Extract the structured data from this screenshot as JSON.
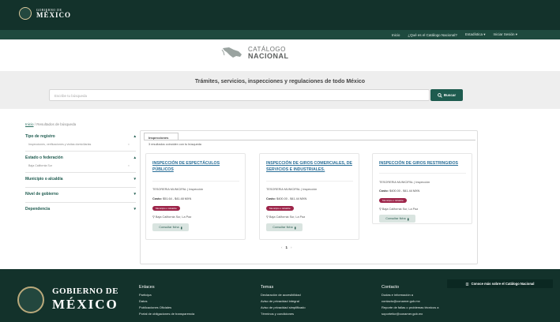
{
  "header": {
    "logo_small": "GOBIERNO DE",
    "logo_big": "MÉXICO"
  },
  "nav": {
    "items": [
      "Inicio",
      "¿Qué es el Catálogo Nacional?",
      "Estadística ▾",
      "Iniciar Sesión ▾"
    ]
  },
  "brand": {
    "line1": "CATÁLOGO",
    "line2": "NACIONAL"
  },
  "hero": {
    "title": "Trámites, servicios, inspecciones y regulaciones de todo México",
    "search_placeholder": "Escribe tu búsqueda",
    "search_button": "Buscar"
  },
  "breadcrumb": {
    "home": "Inicio",
    "sep": " / ",
    "current": "Resultados de búsqueda"
  },
  "sidebar": {
    "filters": [
      {
        "label": "Tipo de registro",
        "sub": "Inspecciones, verificaciones y visitas domiciliarias",
        "chevron": "▴"
      },
      {
        "label": "Estado o federación",
        "sub": "Baja California Sur",
        "chevron": "▴"
      },
      {
        "label": "Municipio o alcaldía",
        "sub": "",
        "chevron": "▾"
      },
      {
        "label": "Nivel de gobierno",
        "sub": "",
        "chevron": "▾"
      },
      {
        "label": "Dependencia",
        "sub": "",
        "chevron": "▾"
      }
    ]
  },
  "results": {
    "tab": "Inspecciones",
    "count": "3 resultados coinciden con tu búsqueda",
    "cards": [
      {
        "title": "Inspección de espectáculos públicos",
        "dependency": "TESORERIA MUNICIPAL | Inspección",
        "cost_label": "Costo:",
        "cost": "$51.64 - $41.48 MXN",
        "badge": "Municipio o Alcaldía",
        "location": "Baja California Sur, La Paz",
        "button": "Consultar ficha"
      },
      {
        "title": "Inspección de giros comerciales, de servicios e industriales.",
        "dependency": "TESORERIA MUNICIPAL | Inspección",
        "cost_label": "Costo:",
        "cost": "$400.00 - $41.44 MXN",
        "badge": "Municipio o Alcaldía",
        "location": "Baja California Sur, La Paz",
        "button": "Consultar ficha"
      },
      {
        "title": "Inspección de giros restringidos",
        "dependency": "TESORERIA MUNICIPAL | Inspección",
        "cost_label": "Costo:",
        "cost": "$400.00 - $41.44 MXN",
        "badge": "Municipio o Alcaldía",
        "location": "Baja California Sur, La Paz",
        "button": "Consultar ficha"
      }
    ],
    "pager": {
      "prev": "‹",
      "current": "1",
      "next": "›"
    }
  },
  "footer": {
    "logo_line1": "GOBIERNO DE",
    "logo_line2": "MÉXICO",
    "cta": "Conoce más sobre el Catálogo Nacional",
    "columns": [
      {
        "heading": "Enlaces",
        "items": [
          "Participa",
          "Datos",
          "Publicaciones Oficiales",
          "Portal de obligaciones de transparencia"
        ]
      },
      {
        "heading": "Temas",
        "items": [
          "Declaración de accesibilidad",
          "Aviso de privacidad integral",
          "Aviso de privacidad simplificado",
          "Términos y condiciones"
        ]
      },
      {
        "heading": "Contacto",
        "items": [
          "Dudas e información a",
          "contacto@conamer.gob.mx",
          "Reporte de fallas o problemas técnicos a",
          "soporteticr@conamer.gob.mx"
        ]
      }
    ]
  },
  "colors": {
    "header_green": "#13322b",
    "nav_green": "#1e4a3e",
    "button_green": "#1e5b4f",
    "badge_red": "#9d2449",
    "title_blue": "#2a6f98"
  }
}
